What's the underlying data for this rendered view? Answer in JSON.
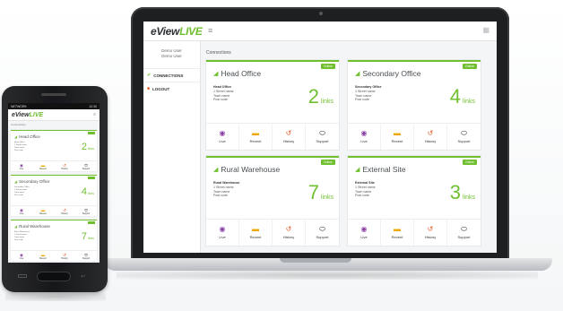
{
  "brand": {
    "logo_main": "eView",
    "logo_accent": "LIVE",
    "accent_color": "#6fbf2f"
  },
  "laptop": {
    "menu_icon": "hamburger-icon",
    "grid_icon": "grid-icon",
    "sidebar": {
      "user_line1": "Demo User",
      "user_line2": "Demo User",
      "items": [
        {
          "icon": "connections-icon",
          "label": "CONNECTIONS"
        },
        {
          "icon": "logout-icon",
          "label": "LOGOUT"
        }
      ]
    },
    "main": {
      "title": "Connections",
      "cards": [
        {
          "name": "Head Office",
          "badge": "Online",
          "info_title": "Head Office",
          "info_lines": [
            "1 Street name",
            "Town name",
            "Post code"
          ],
          "links_count": "2",
          "links_label": "links"
        },
        {
          "name": "Secondary Office",
          "badge": "Online",
          "info_title": "Secondary Office",
          "info_lines": [
            "1 Street name",
            "Town name",
            "Post code"
          ],
          "links_count": "4",
          "links_label": "links"
        },
        {
          "name": "Rural Warehouse",
          "badge": "Online",
          "info_title": "Rural Warehouse",
          "info_lines": [
            "1 Street name",
            "Town name",
            "Post code"
          ],
          "links_count": "7",
          "links_label": "links"
        },
        {
          "name": "External Site",
          "badge": "Online",
          "info_title": "External Site",
          "info_lines": [
            "1 Street name",
            "Town name",
            "Post code"
          ],
          "links_count": "3",
          "links_label": "links"
        }
      ],
      "actions": [
        {
          "label": "Live",
          "icon": "eye-icon"
        },
        {
          "label": "Recent",
          "icon": "folder-icon"
        },
        {
          "label": "History",
          "icon": "history-icon"
        },
        {
          "label": "Support",
          "icon": "chat-icon"
        }
      ]
    }
  },
  "phone": {
    "status_left": "NETWORK",
    "status_right": "12:30",
    "sub": "Connections",
    "cards": [
      {
        "name": "Head Office",
        "info_lines": [
          "Head Office",
          "1 Street name",
          "Town name",
          "Post code"
        ],
        "links_count": "2",
        "links_label": "links"
      },
      {
        "name": "Secondary Office",
        "info_lines": [
          "Secondary Office",
          "1 Street name",
          "Town name",
          "Post code"
        ],
        "links_count": "4",
        "links_label": "links"
      },
      {
        "name": "Rural Warehouse",
        "info_lines": [
          "Rural Warehouse",
          "1 Street name",
          "Town name",
          "Post code"
        ],
        "links_count": "7",
        "links_label": "links"
      }
    ],
    "actions": [
      "Live",
      "Recent",
      "History",
      "Support"
    ]
  }
}
